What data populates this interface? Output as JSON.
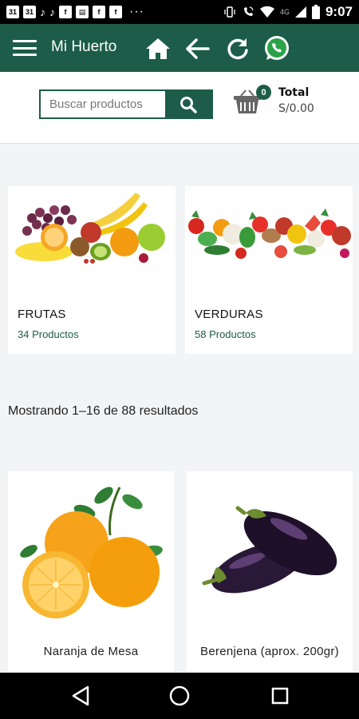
{
  "status_bar": {
    "time": "9:07",
    "network": "4G",
    "left_icons": [
      "calendar-icon",
      "calendar-icon",
      "tiktok-icon",
      "tiktok-icon",
      "facebook-icon",
      "document-icon",
      "facebook-icon",
      "facebook-icon"
    ],
    "right_icons": [
      "vibrate-icon",
      "wifi-call-icon",
      "wifi-icon",
      "signal-icon",
      "battery-icon"
    ],
    "calendar_day": "31"
  },
  "app_bar": {
    "title": "Mi Huerto",
    "actions": [
      "home-icon",
      "back-arrow-icon",
      "refresh-icon",
      "whatsapp-icon"
    ]
  },
  "search": {
    "placeholder": "Buscar productos"
  },
  "cart": {
    "count": "0",
    "total_label": "Total",
    "total_value": "S/0.00"
  },
  "categories": [
    {
      "name": "FRUTAS",
      "count": "34 Productos"
    },
    {
      "name": "VERDURAS",
      "count": "58 Productos"
    }
  ],
  "results_text": "Mostrando 1–16 de 88 resultados",
  "products": [
    {
      "name": "Naranja de Mesa"
    },
    {
      "name": "Berenjena (aprox. 200gr)"
    }
  ],
  "colors": {
    "brand": "#1c5c48",
    "background": "#f3f4f6"
  }
}
